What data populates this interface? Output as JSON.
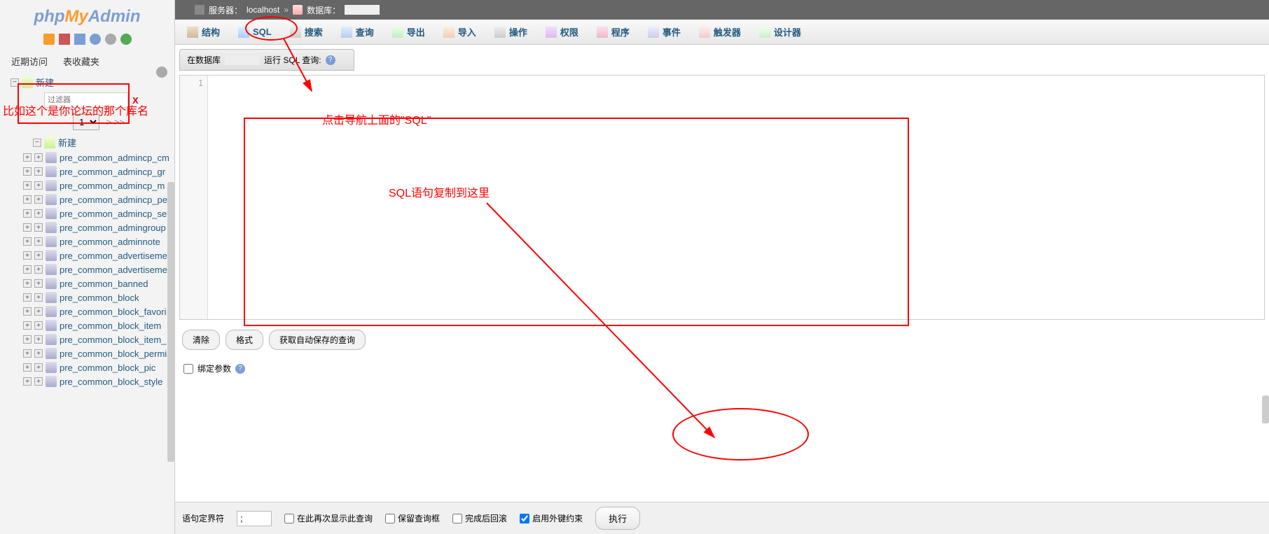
{
  "logo": {
    "php": "php",
    "my": "My",
    "admin": "Admin"
  },
  "sidebar": {
    "recent": "近期访问",
    "fav": "表收藏夹",
    "new_top": "新建",
    "filter_placeholder": "过滤器",
    "filter_x": "X",
    "page": "1",
    "page_more": "> >>",
    "new_sub": "新建",
    "tables": [
      "pre_common_admincp_cm",
      "pre_common_admincp_gr",
      "pre_common_admincp_m",
      "pre_common_admincp_pe",
      "pre_common_admincp_se",
      "pre_common_admingroup",
      "pre_common_adminnote",
      "pre_common_advertiseme",
      "pre_common_advertiseme",
      "pre_common_banned",
      "pre_common_block",
      "pre_common_block_favori",
      "pre_common_block_item",
      "pre_common_block_item_",
      "pre_common_block_permi",
      "pre_common_block_pic",
      "pre_common_block_style"
    ]
  },
  "breadcrumb": {
    "server_label": "服务器：",
    "server_name": "localhost",
    "sep": "»",
    "db_label": "数据库："
  },
  "toolbar": {
    "items": [
      {
        "icon": "ic-struct",
        "label": "结构"
      },
      {
        "icon": "ic-sql",
        "label": "SQL"
      },
      {
        "icon": "ic-search",
        "label": "搜索"
      },
      {
        "icon": "ic-query",
        "label": "查询"
      },
      {
        "icon": "ic-export",
        "label": "导出"
      },
      {
        "icon": "ic-import",
        "label": "导入"
      },
      {
        "icon": "ic-ops",
        "label": "操作"
      },
      {
        "icon": "ic-priv",
        "label": "权限"
      },
      {
        "icon": "ic-routine",
        "label": "程序"
      },
      {
        "icon": "ic-event",
        "label": "事件"
      },
      {
        "icon": "ic-trig",
        "label": "触发器"
      },
      {
        "icon": "ic-design",
        "label": "设计器"
      }
    ]
  },
  "panel": {
    "head_prefix": "在数据库",
    "head_suffix": "运行 SQL 查询:",
    "line_no": "1"
  },
  "under": {
    "clear": "清除",
    "format": "格式",
    "autosave": "获取自动保存的查询"
  },
  "bind": {
    "label": "绑定参数"
  },
  "footer": {
    "delim_label": "语句定界符",
    "delim_val": ";",
    "show_again": "在此再次显示此查询",
    "retain": "保留查询框",
    "rollback": "完成后回滚",
    "fk": "启用外键约束",
    "exec": "执行"
  },
  "anno": {
    "left": "比如这个是你论坛的那个库名",
    "top": "点击导航上面的\"SQL\"",
    "mid": "SQL语句复制到这里"
  }
}
